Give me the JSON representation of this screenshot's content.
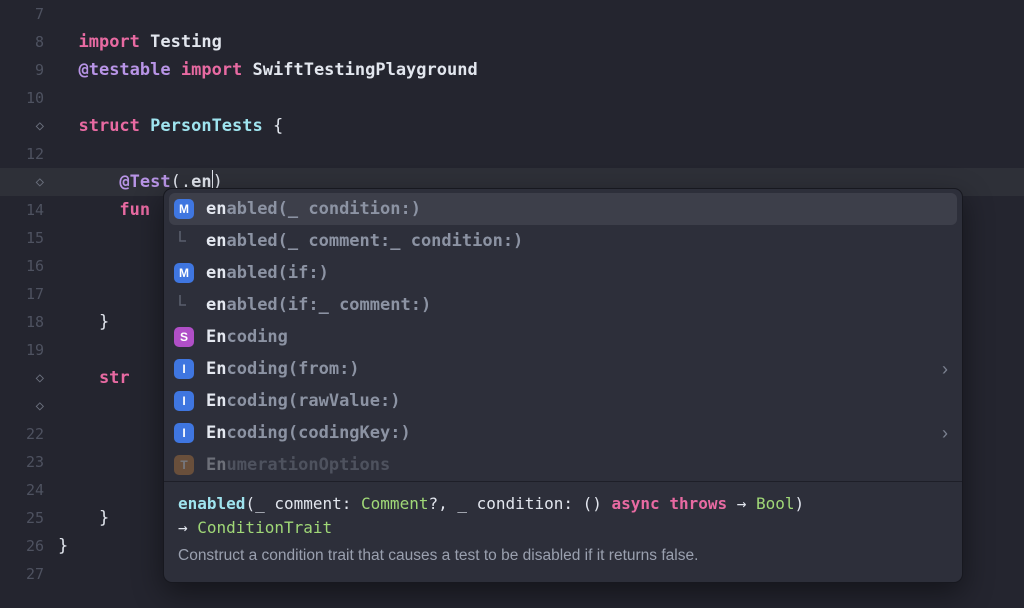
{
  "gutter": {
    "line7": "7",
    "line8": "8",
    "line9": "9",
    "line10": "10",
    "line12": "12",
    "line14": "14",
    "line15": "15",
    "line16": "16",
    "line17": "17",
    "line18": "18",
    "line19": "19",
    "line22": "22",
    "line23": "23",
    "line24": "24",
    "line25": "25",
    "line26": "26",
    "line27": "27",
    "diamond": "◇"
  },
  "code": {
    "l8_kw": "import",
    "l8_id": "Testing",
    "l9_attr": "@testable",
    "l9_kw": "import",
    "l9_id": "SwiftTestingPlayground",
    "l11_kw": "struct",
    "l11_id": "PersonTests",
    "l11_brace": " {",
    "l13_attr": "@Test",
    "l13_open": "(.",
    "l13_typed": "en",
    "l13_close": ")",
    "l14_fun": "fun",
    "l18_brace": "    }",
    "l20_str": "    str",
    "l25_brace": "    }",
    "l26_brace": "}"
  },
  "suggestions": [
    {
      "icon": "M",
      "prefix": "en",
      "rest": "abled",
      "params": "(_ condition:)",
      "chevron": false
    },
    {
      "icon": "none",
      "prefix": "en",
      "rest": "abled",
      "params": "(_ comment:_ condition:)",
      "chevron": false
    },
    {
      "icon": "M",
      "prefix": "en",
      "rest": "abled",
      "params": "(if:)",
      "chevron": false
    },
    {
      "icon": "none",
      "prefix": "en",
      "rest": "abled",
      "params": "(if:_ comment:)",
      "chevron": false
    },
    {
      "icon": "S",
      "prefix": "En",
      "rest": "coding",
      "params": "",
      "chevron": false
    },
    {
      "icon": "I",
      "prefix": "En",
      "rest": "coding",
      "params": "(from:)",
      "chevron": true
    },
    {
      "icon": "I",
      "prefix": "En",
      "rest": "coding",
      "params": "(rawValue:)",
      "chevron": false
    },
    {
      "icon": "I",
      "prefix": "En",
      "rest": "coding",
      "params": "(codingKey:)",
      "chevron": true
    },
    {
      "icon": "T",
      "prefix": "En",
      "rest": "umerationOptions",
      "params": "",
      "chevron": false
    }
  ],
  "doc": {
    "fn": "enabled",
    "sig_part1": "(_ comment: ",
    "type1": "Comment",
    "opt": "?",
    "sep": ", ",
    "sig_part2": "_ condition: () ",
    "kw1": "async",
    "kw2": "throws",
    "arrow1": " → ",
    "type2": "Bool",
    "close": ")",
    "arrow2": "→ ",
    "ret": "ConditionTrait",
    "desc": "Construct a condition trait that causes a test to be disabled if it returns false."
  }
}
